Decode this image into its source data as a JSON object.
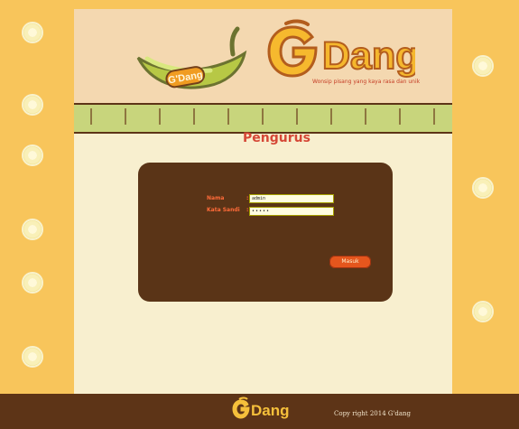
{
  "site": {
    "brand": "Dang",
    "logo_text": "G'Dang",
    "tagline": "Wonsip pisang yang kaya rasa dan unik"
  },
  "page": {
    "title": "Pengurus"
  },
  "login_form": {
    "name_label": "Nama",
    "password_label": "Kata Sandi",
    "separator": ":",
    "username_value": "admin",
    "password_value": "•••••",
    "submit_label": "Masuk"
  },
  "footer": {
    "logo_text": "Dang",
    "copyright": "Copy right 2014 G'dang"
  },
  "colors": {
    "background_orange": "#f7b73d",
    "panel_cream": "#f8efcf",
    "header_peach": "#f4d8b0",
    "band_green": "#c8d57c",
    "dark_brown": "#5a3417",
    "accent_red": "#d54736",
    "button_orange": "#e5561d"
  }
}
